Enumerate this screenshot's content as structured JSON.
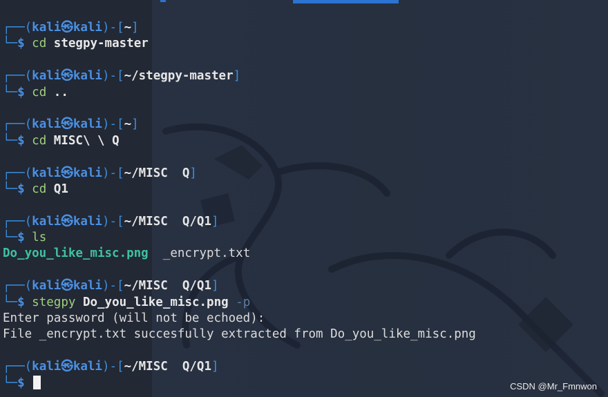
{
  "prompt": {
    "user": "kali",
    "at": "㉿",
    "host": "kali",
    "dollar": "$",
    "box_top": "┌──(",
    "box_close": ")-[",
    "box_end": "]",
    "box_bottom": "└─"
  },
  "blocks": [
    {
      "path": "~",
      "cmd": "cd",
      "args": "stegpy-master",
      "flag": ""
    },
    {
      "path": "~/stegpy-master",
      "cmd": "cd",
      "args": "..",
      "flag": ""
    },
    {
      "path": "~",
      "cmd": "cd",
      "args": "MISC\\ \\ Q",
      "flag": ""
    },
    {
      "path": "~/MISC  Q",
      "cmd": "cd",
      "args": "Q1",
      "flag": ""
    },
    {
      "path": "~/MISC  Q/Q1",
      "cmd": "ls",
      "args": "",
      "flag": ""
    },
    {
      "path": "~/MISC  Q/Q1",
      "cmd": "stegpy",
      "args": "Do_you_like_misc.png",
      "flag": "-p"
    },
    {
      "path": "~/MISC  Q/Q1",
      "cmd": "",
      "args": "",
      "flag": ""
    }
  ],
  "ls_output": {
    "file1": "Do_you_like_misc.png",
    "file2": "_encrypt.txt"
  },
  "stegpy_output": {
    "line1": "Enter password (will not be echoed):",
    "line2": "File _encrypt.txt succesfully extracted from Do_you_like_misc.png"
  },
  "watermark": "CSDN @Mr_Fmnwon",
  "colors": {
    "background": "#1f2531",
    "prompt_blue": "#3a8fe0",
    "command_green": "#9fd07e",
    "png_file_teal": "#3fc1a0",
    "tab_blue": "#2c73d2"
  }
}
